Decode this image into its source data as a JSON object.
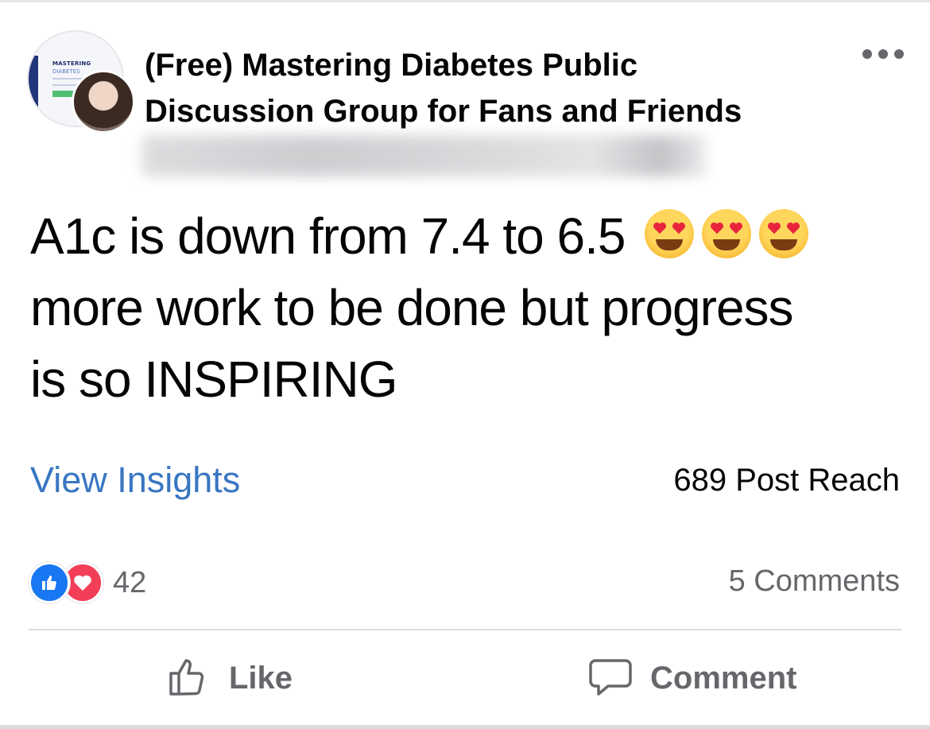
{
  "post": {
    "group_name_line1": "(Free) Mastering Diabetes Public",
    "group_name_line2": "Discussion Group for Fans and Friends",
    "avatar_logo_text": "MASTERING",
    "avatar_logo_sub": "DIABETES",
    "text_line1": "A1c is down from 7.4 to 6.5",
    "text_line2": "more work to be done but progress",
    "text_line3": "is so INSPIRING",
    "emojis": [
      "heart-eyes",
      "heart-eyes",
      "heart-eyes"
    ]
  },
  "insights": {
    "view_label": "View Insights",
    "reach_label": "689 Post Reach"
  },
  "engagement": {
    "reactions": [
      "like",
      "love"
    ],
    "reaction_count": "42",
    "comments_label": "5 Comments"
  },
  "actions": {
    "like_label": "Like",
    "comment_label": "Comment"
  },
  "colors": {
    "link": "#3876c2",
    "like_blue": "#1877f2",
    "love_red": "#f33e58",
    "secondary_text": "#65676b"
  }
}
